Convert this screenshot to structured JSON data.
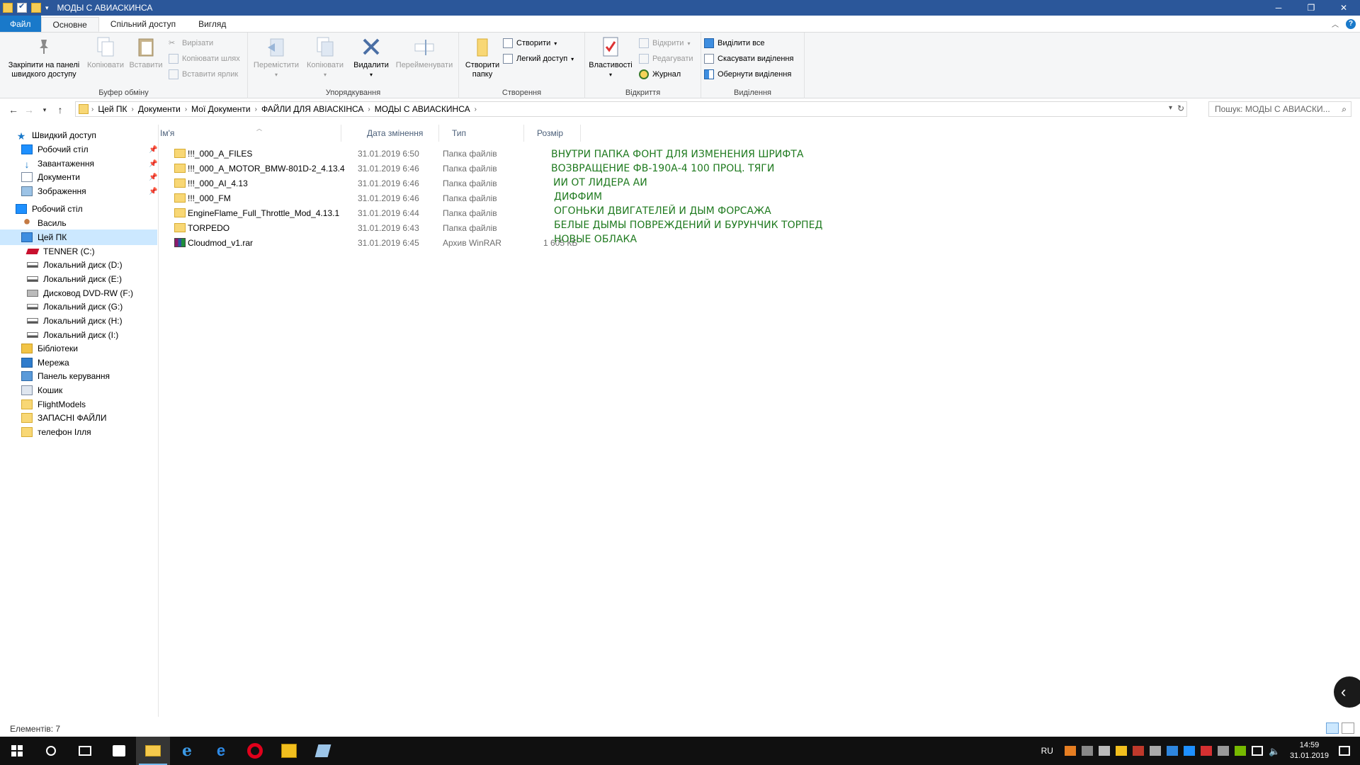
{
  "window": {
    "title": "МОДЫ С АВИАСКИНСА",
    "minimize": "─",
    "maximize": "❐",
    "close": "✕"
  },
  "tabs": {
    "file": "Файл",
    "home": "Основне",
    "share": "Спільний доступ",
    "view": "Вигляд"
  },
  "ribbon": {
    "clipboard": {
      "label": "Буфер обміну",
      "pin": "Закріпити на панелі швидкого доступу",
      "copy": "Копіювати",
      "paste": "Вставити",
      "cut": "Вирізати",
      "copy_path": "Копіювати шлях",
      "paste_shortcut": "Вставити ярлик"
    },
    "organize": {
      "label": "Упорядкування",
      "move": "Перемістити",
      "copy": "Копіювати",
      "delete": "Видалити",
      "rename": "Перейменувати"
    },
    "new": {
      "label": "Створення",
      "new_folder": "Створити папку",
      "new_item": "Створити",
      "easy_access": "Легкий доступ"
    },
    "open": {
      "label": "Відкриття",
      "properties": "Властивості",
      "open": "Відкрити",
      "edit": "Редагувати",
      "history": "Журнал"
    },
    "select": {
      "label": "Виділення",
      "select_all": "Виділити все",
      "select_none": "Скасувати виділення",
      "invert": "Обернути виділення"
    }
  },
  "address": {
    "crumbs": [
      "Цей ПК",
      "Документи",
      "Мої Документи",
      "ФАЙЛИ ДЛЯ АВІАСКІНСА",
      "МОДЫ С АВИАСКИНСА"
    ],
    "search_placeholder": "Пошук: МОДЫ С АВИАСКИ..."
  },
  "nav": [
    {
      "label": "Швидкий доступ",
      "icon": "star-icon"
    },
    {
      "label": "Робочий стіл",
      "icon": "desktop-icon",
      "pinned": true
    },
    {
      "label": "Завантаження",
      "icon": "downloads-icon",
      "pinned": true
    },
    {
      "label": "Документи",
      "icon": "documents-icon",
      "pinned": true
    },
    {
      "label": "Зображення",
      "icon": "pictures-icon",
      "pinned": true
    },
    {
      "label": "Робочий стіл",
      "icon": "desktop-icon"
    },
    {
      "label": "Василь",
      "icon": "user-icon"
    },
    {
      "label": "Цей ПК",
      "icon": "computer-icon",
      "selected": true
    },
    {
      "label": "TENNER (C:)",
      "icon": "drive-icon"
    },
    {
      "label": "Локальний диск (D:)",
      "icon": "drive-icon"
    },
    {
      "label": "Локальний диск (E:)",
      "icon": "drive-icon"
    },
    {
      "label": "Дисковод DVD-RW (F:)",
      "icon": "dvd-drive-icon"
    },
    {
      "label": "Локальний диск (G:)",
      "icon": "drive-icon"
    },
    {
      "label": "Локальний диск (H:)",
      "icon": "drive-icon"
    },
    {
      "label": "Локальний диск (I:)",
      "icon": "drive-icon"
    },
    {
      "label": "Бібліотеки",
      "icon": "libraries-icon"
    },
    {
      "label": "Мережа",
      "icon": "network-icon"
    },
    {
      "label": "Панель керування",
      "icon": "control-panel-icon"
    },
    {
      "label": "Кошик",
      "icon": "recycle-bin-icon"
    },
    {
      "label": "FlightModels",
      "icon": "folder-icon"
    },
    {
      "label": "ЗАПАСНІ ФАЙЛИ",
      "icon": "folder-icon"
    },
    {
      "label": "телефон Ілля",
      "icon": "folder-icon"
    }
  ],
  "columns": {
    "name": "Ім'я",
    "date": "Дата змінення",
    "type": "Тип",
    "size": "Розмір"
  },
  "files": [
    {
      "name": "!!!_000_A_FILES",
      "date": "31.01.2019 6:50",
      "type": "Папка файлів",
      "size": "",
      "icon": "folder-icon"
    },
    {
      "name": "!!!_000_A_MOTOR_BMW-801D-2_4.13.4",
      "date": "31.01.2019 6:46",
      "type": "Папка файлів",
      "size": "",
      "icon": "folder-icon"
    },
    {
      "name": "!!!_000_AI_4.13",
      "date": "31.01.2019 6:46",
      "type": "Папка файлів",
      "size": "",
      "icon": "folder-icon"
    },
    {
      "name": "!!!_000_FM",
      "date": "31.01.2019 6:46",
      "type": "Папка файлів",
      "size": "",
      "icon": "folder-icon"
    },
    {
      "name": "EngineFlame_Full_Throttle_Mod_4.13.1",
      "date": "31.01.2019 6:44",
      "type": "Папка файлів",
      "size": "",
      "icon": "folder-icon"
    },
    {
      "name": "TORPEDO",
      "date": "31.01.2019 6:43",
      "type": "Папка файлів",
      "size": "",
      "icon": "folder-icon"
    },
    {
      "name": "Cloudmod_v1.rar",
      "date": "31.01.2019 6:45",
      "type": "Архив WinRAR",
      "size": "1 605 КБ",
      "icon": "winrar-icon"
    }
  ],
  "notes": [
    "ВНУТРИ ПАПКА ФОНТ ДЛЯ ИЗМЕНЕНИЯ ШРИФТА",
    "ВОЗВРАЩЕНИЕ ФВ-190А-4 100 ПРОЦ. ТЯГИ",
    "ИИ ОТ ЛИДЕРА АИ",
    "ДИФФИМ",
    "ОГОНЬКИ ДВИГАТЕЛЕЙ И ДЫМ ФОРСАЖА",
    "БЕЛЫЕ ДЫМЫ ПОВРЕЖДЕНИЙ И БУРУНЧИК ТОРПЕД",
    "НОВЫЕ ОБЛАКА"
  ],
  "status": {
    "items": "Елементів: 7"
  },
  "taskbar": {
    "lang": "RU",
    "time": "14:59",
    "date": "31.01.2019"
  },
  "colors": {
    "titlebar": "#2b579a",
    "file_tab": "#1979ca",
    "note_green": "#1f7a1f",
    "selection": "#cce8ff"
  }
}
